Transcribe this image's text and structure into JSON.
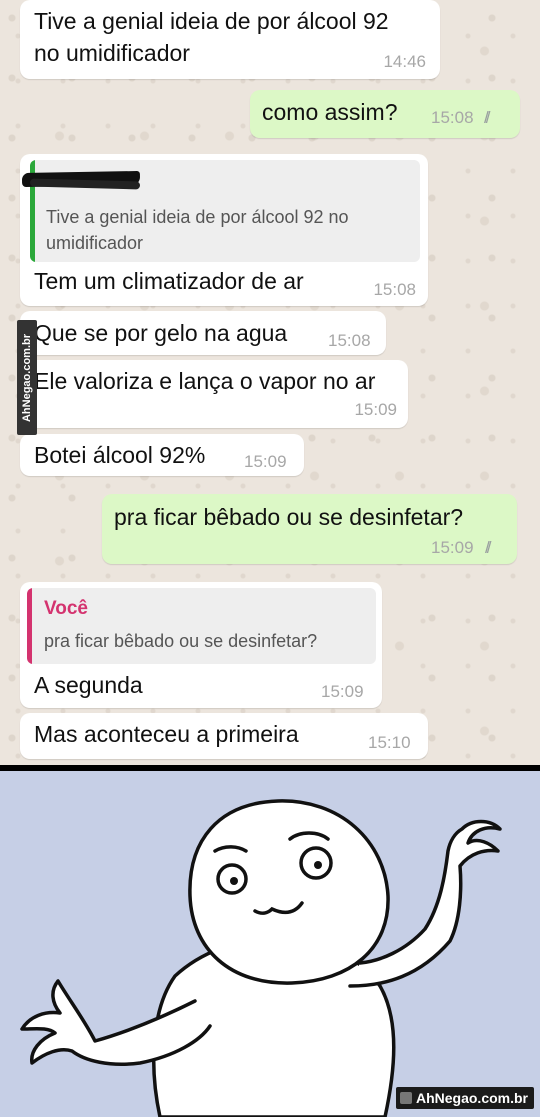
{
  "watermark_side": "AhNegao.com.br",
  "watermark_badge": "AhNegao.com.br",
  "messages": [
    {
      "text_lines": [
        "Tive a genial ideia de por álcool 92",
        "no umidificador"
      ],
      "time": "14:46",
      "direction": "incoming"
    },
    {
      "text": "como assim?",
      "time": "15:08",
      "direction": "outgoing",
      "ticks": "//"
    },
    {
      "quote_lines": [
        "Tive a genial ideia de por álcool 92 no",
        "umidificador"
      ],
      "quote_color": "#2ba83a",
      "text": "Tem um climatizador de ar",
      "time": "15:08",
      "direction": "incoming"
    },
    {
      "text": "Que se por gelo na agua",
      "time": "15:08",
      "direction": "incoming"
    },
    {
      "text": "Ele valoriza e lança o vapor no ar",
      "time": "15:09",
      "direction": "incoming"
    },
    {
      "text": "Botei álcool 92%",
      "time": "15:09",
      "direction": "incoming"
    },
    {
      "text": "pra ficar bêbado ou se desinfetar?",
      "time": "15:09",
      "direction": "outgoing",
      "ticks": "//"
    },
    {
      "quote_author": "Você",
      "quote_text": "pra ficar bêbado ou se desinfetar?",
      "quote_color": "#d4336f",
      "text": "A segunda",
      "time": "15:09",
      "direction": "incoming"
    },
    {
      "text": "Mas aconteceu a primeira",
      "time": "15:10",
      "direction": "incoming"
    }
  ],
  "colors": {
    "chat_bg": "#ece5dd",
    "incoming_bubble": "#ffffff",
    "outgoing_bubble": "#dcf8c6",
    "meme_bg": "#c6cfe6"
  }
}
